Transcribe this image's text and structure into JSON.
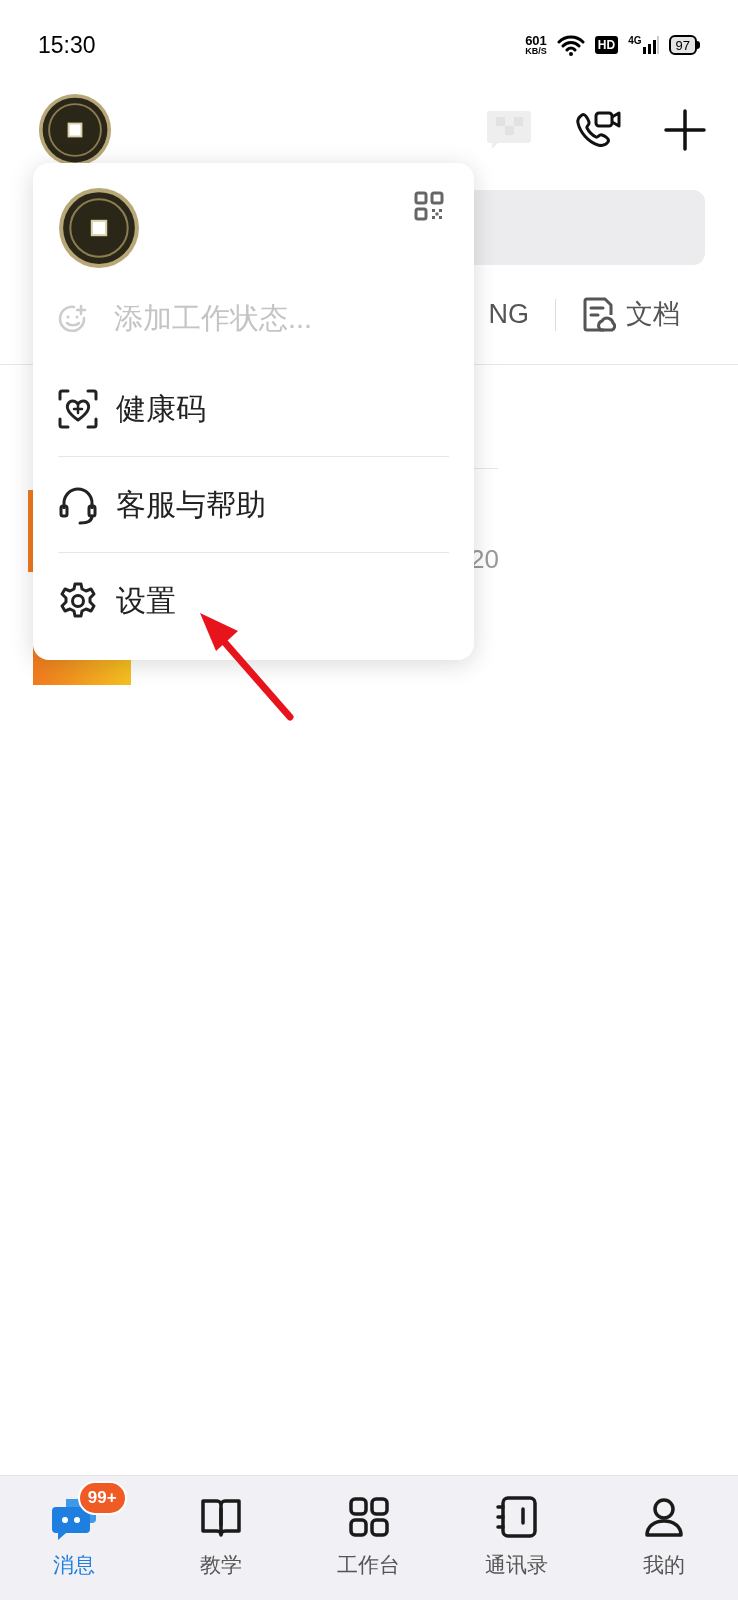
{
  "status_bar": {
    "time": "15:30",
    "net_speed": "601",
    "net_unit": "KB/S",
    "hd": "HD",
    "network": "4G",
    "battery": "97"
  },
  "background": {
    "tabs": [
      {
        "kind": "text",
        "label": "NG"
      },
      {
        "kind": "doc",
        "label": "文档"
      }
    ],
    "list_text": "20"
  },
  "menu": {
    "status_placeholder": "添加工作状态...",
    "items": [
      {
        "kind": "health",
        "label": "健康码"
      },
      {
        "kind": "support",
        "label": "客服与帮助"
      },
      {
        "kind": "settings",
        "label": "设置"
      }
    ]
  },
  "bottom_nav": [
    {
      "kind": "chat",
      "label": "消息",
      "selected": true,
      "badge": "99+"
    },
    {
      "kind": "book",
      "label": "教学",
      "selected": false
    },
    {
      "kind": "grid",
      "label": "工作台",
      "selected": false
    },
    {
      "kind": "contacts",
      "label": "通讯录",
      "selected": false
    },
    {
      "kind": "person",
      "label": "我的",
      "selected": false
    }
  ]
}
